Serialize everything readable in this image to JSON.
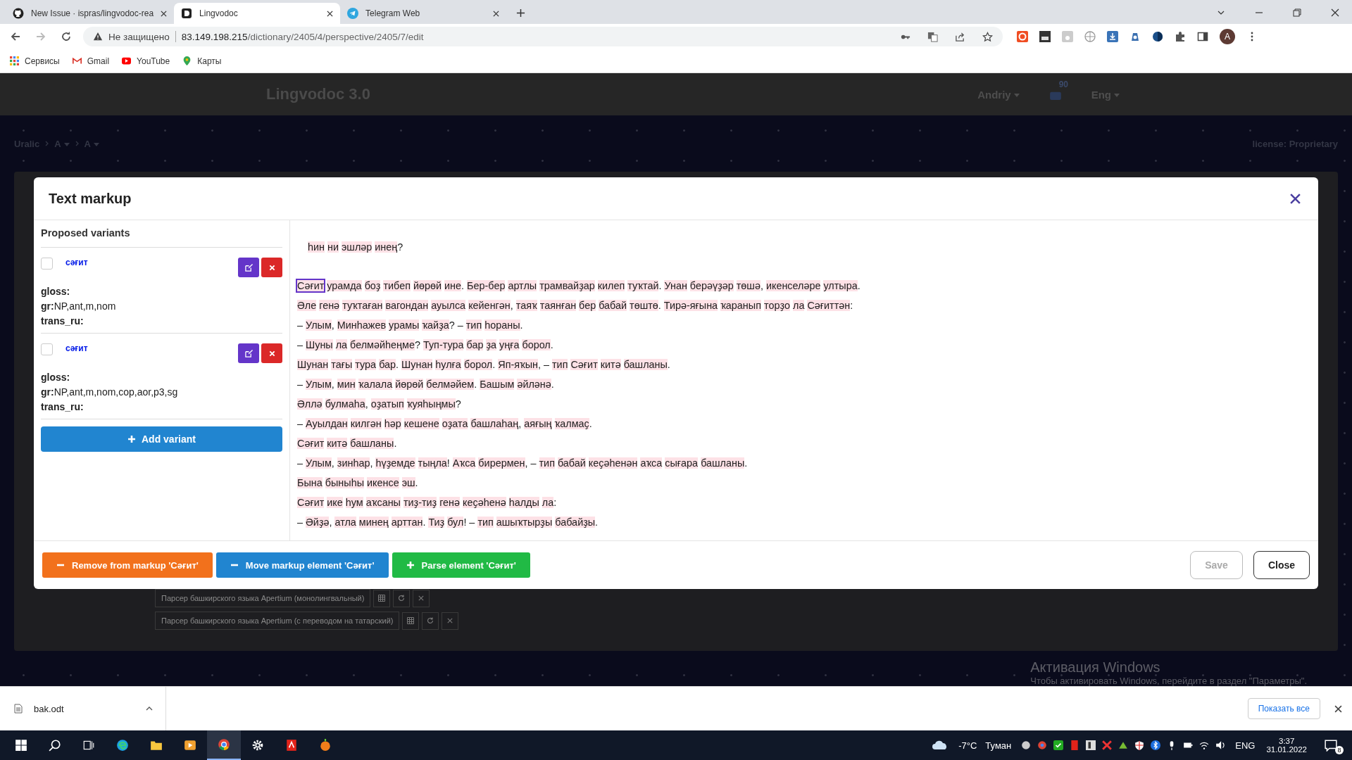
{
  "browser": {
    "tabs": [
      {
        "title": "New Issue · ispras/lingvodoc-rea",
        "selected": false
      },
      {
        "title": "Lingvodoc",
        "selected": true
      },
      {
        "title": "Telegram Web",
        "selected": false
      }
    ],
    "security": "Не защищено",
    "url_host": "83.149.198.215",
    "url_path": "/dictionary/2405/4/perspective/2405/7/edit",
    "profile_initial": "A",
    "bookmarks": [
      "Сервисы",
      "Gmail",
      "YouTube",
      "Карты"
    ]
  },
  "app": {
    "logo": "Lingvodoc 3.0",
    "user": "Andriy",
    "notifications": "90",
    "language": "Eng",
    "breadcrumbs": [
      "Uralic",
      "A",
      "A"
    ],
    "license": "license: Proprietary",
    "parsers": [
      "Парсер башкирского языка Apertium (монолингвальный)",
      "Парсер башкирского языка Apertium (с переводом на татарский)"
    ]
  },
  "modal": {
    "title": "Text markup",
    "variants_heading": "Proposed variants",
    "variants": [
      {
        "word": "сәғит",
        "checked": false,
        "fields": [
          {
            "label": "gloss:"
          },
          {
            "label": "gr:",
            "value": "NP,ant,m,nom"
          },
          {
            "label": "trans_ru:"
          }
        ]
      },
      {
        "word": "сәғит",
        "checked": false,
        "fields": [
          {
            "label": "gloss:"
          },
          {
            "label": "gr:",
            "value": "NP,ant,m,nom,cop,aor,p3,sg"
          },
          {
            "label": "trans_ru:"
          }
        ]
      }
    ],
    "add_variant": "Add variant",
    "title_line": "һин ни эшләр инең?",
    "lines": [
      {
        "segments": [
          {
            "text": "Сәғит",
            "selected": true
          },
          {
            "text": " урамда боҙ тибеп йөрөй ине. Бер-бер артлы трамвайҙар килеп туҡтай. Унан берәүҙәр төшә, икенселәре ултыра.",
            "selected": false
          }
        ]
      },
      {
        "segments": [
          {
            "text": "Әле генә туҡтаған вагондан ауылса кейенгән, таяҡ таянған бер бабай төштө. Тирә-яғына ҡаранып торҙо ла Сәғиттән:",
            "selected": false
          }
        ]
      },
      {
        "segments": [
          {
            "text": "– Улым, Минһажев урамы ҡайҙа? – тип һораны.",
            "selected": false
          }
        ]
      },
      {
        "segments": [
          {
            "text": "– Шуны ла белмәйһеңме? Туп-тура бар ҙа уңға борол.",
            "selected": false
          }
        ]
      },
      {
        "segments": [
          {
            "text": "Шунан тағы тура бар. Шунан һулға борол. Яп-яҡын, – тип Сәғит китә башланы.",
            "selected": false
          }
        ]
      },
      {
        "segments": [
          {
            "text": "– Улым, мин ҡалала йөрөй белмәйем. Башым әйләнә.",
            "selected": false
          }
        ]
      },
      {
        "segments": [
          {
            "text": "Әллә булмаһа, оҙатып ҡуяһыңмы?",
            "selected": false
          }
        ]
      },
      {
        "segments": [
          {
            "text": "– Ауылдан килгән һәр кешене оҙата башлаһаң, аяғың ҡалмаҫ.",
            "selected": false
          }
        ]
      },
      {
        "segments": [
          {
            "text": "Сәғит китә башланы.",
            "selected": false
          }
        ]
      },
      {
        "segments": [
          {
            "text": "– Улым, зинһар, һүҙемде тыңла! Аҡса бирермен, – тип бабай кеҫәһенән аҡса сығара башланы.",
            "selected": false
          }
        ]
      },
      {
        "segments": [
          {
            "text": "Бына быныһы икенсе эш.",
            "selected": false
          }
        ]
      },
      {
        "segments": [
          {
            "text": "Сәғит ике һум аҡсаны тиҙ-тиҙ генә кеҫәһенә һалды ла:",
            "selected": false
          }
        ]
      },
      {
        "segments": [
          {
            "text": "– Әйҙә, атла минең арттан. Тиҙ бул! – тип ашыҡтырҙы бабайҙы.",
            "selected": false
          }
        ]
      }
    ],
    "actions": [
      {
        "label": "Remove from markup 'Сәғит'",
        "kind": "remove"
      },
      {
        "label": "Move markup element 'Сәғит'",
        "kind": "move"
      },
      {
        "label": "Parse element 'Сәғит'",
        "kind": "parse"
      }
    ],
    "save": {
      "label": "Save",
      "disabled": true
    },
    "close": "Close"
  },
  "os_notice": {
    "title": "Активация Windows",
    "text": "Чтобы активировать Windows, перейдите в раздел \"Параметры\"."
  },
  "download": {
    "file": "bak.odt",
    "show_all": "Показать все"
  },
  "taskbar": {
    "temperature": "-7°C",
    "weather": "Туман",
    "language": "ENG",
    "time": "3:37",
    "date": "31.01.2022",
    "notifications": "8"
  }
}
